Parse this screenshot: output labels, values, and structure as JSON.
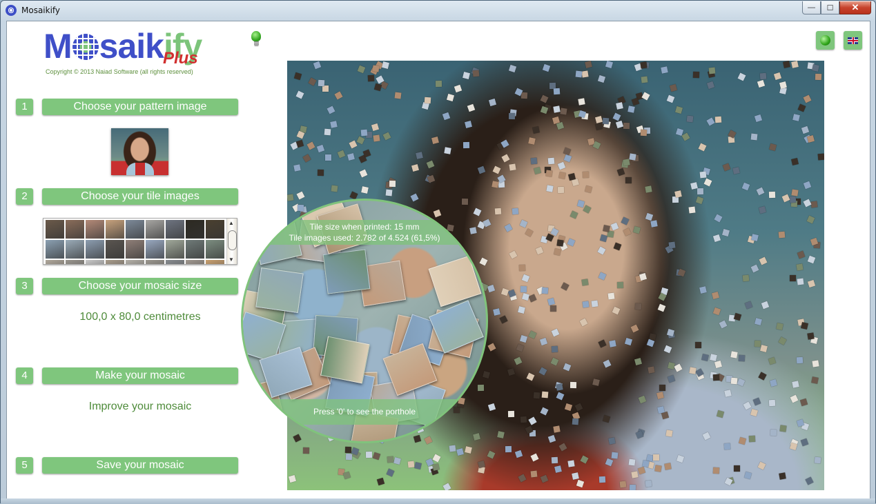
{
  "window": {
    "title": "Mosaikify",
    "controls": {
      "minimize": "—",
      "maximize": "☐",
      "close": "✕"
    }
  },
  "header": {
    "logo_text_1": "M",
    "logo_text_2": "saik",
    "logo_text_3": "ify",
    "logo_plus": "Plus",
    "copyright": "Copyright © 2013 Naiad Software (all rights reserved)",
    "icons": [
      "lightbulb-icon",
      "globe-icon",
      "uk-flag-icon"
    ]
  },
  "steps": [
    {
      "number": "1",
      "label": "Choose your pattern image"
    },
    {
      "number": "2",
      "label": "Choose your tile images"
    },
    {
      "number": "3",
      "label": "Choose your mosaic size",
      "info": "100,0 x 80,0 centimetres"
    },
    {
      "number": "4",
      "label": "Make your mosaic",
      "info": "Improve your mosaic"
    },
    {
      "number": "5",
      "label": "Save your mosaic"
    }
  ],
  "tile_list": {
    "colors": [
      "#6b5a4a",
      "#8a6d5a",
      "#b48a78",
      "#c7a27d",
      "#7d8a99",
      "#a7a6a3",
      "#6e7480",
      "#2d2a22",
      "#4a4030",
      "#8ba0b2",
      "#9aabb8",
      "#8c9db0",
      "#5a5550",
      "#8f7f78",
      "#98a8c0",
      "#a0a89a",
      "#6f7a78",
      "#7c8d80",
      "#b0a89c",
      "#9a968f",
      "#c8c8c8",
      "#a89c8c",
      "#b4b0a8",
      "#9c9890",
      "#888c90",
      "#a09890",
      "#c8a070"
    ]
  },
  "porthole": {
    "tile_size_line": "Tile size when printed:  15 mm",
    "tile_used_line": "Tile images used:  2.782 of 4.524  (61,5%)",
    "hint": "Press '0' to see the porthole"
  },
  "colors": {
    "accent_green": "#7fc67d",
    "logo_blue": "#3f4fc8",
    "logo_red": "#d12f2f",
    "info_green": "#4e8b3a"
  }
}
